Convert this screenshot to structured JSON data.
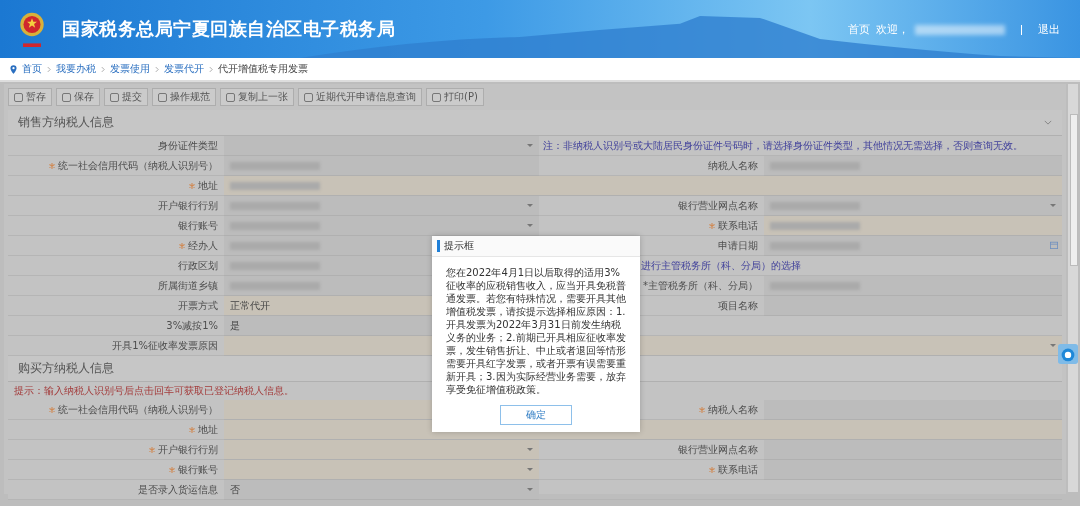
{
  "header": {
    "title": "国家税务总局宁夏回族自治区电子税务局",
    "home_link": "首页",
    "welcome": "欢迎，",
    "logout": "退出"
  },
  "breadcrumb": [
    {
      "label": "首页",
      "current": false
    },
    {
      "label": "我要办税",
      "current": false
    },
    {
      "label": "发票使用",
      "current": false
    },
    {
      "label": "发票代开",
      "current": false
    },
    {
      "label": "代开增值税专用发票",
      "current": true
    }
  ],
  "toolbar": [
    {
      "label": "暂存"
    },
    {
      "label": "保存"
    },
    {
      "label": "提交"
    },
    {
      "label": "操作规范"
    },
    {
      "label": "复制上一张"
    },
    {
      "label": "近期代开申请信息查询"
    },
    {
      "label": "打印(P)"
    }
  ],
  "sections": [
    {
      "title": "销售方纳税人信息",
      "collapsible": true,
      "rows": [
        [
          {
            "kind": "select",
            "label": "身份证件类型",
            "required": false,
            "editable": false,
            "blurred": false
          },
          {
            "kind": "note",
            "text": "注：非纳税人识别号或大陆居民身份证件号码时，请选择身份证件类型，其他情况无需选择，否则查询无效。"
          }
        ],
        [
          {
            "kind": "input",
            "label": "统一社会信用代码（纳税人识别号）",
            "required": true,
            "editable": false,
            "blurred": true
          },
          {
            "kind": "input",
            "label": "纳税人名称",
            "required": false,
            "editable": false,
            "blurred": true
          }
        ],
        [
          {
            "kind": "wide",
            "label": "地址",
            "required": true,
            "editable": true,
            "blurred": true
          }
        ],
        [
          {
            "kind": "select",
            "label": "开户银行行别",
            "required": false,
            "editable": false,
            "blurred": true
          },
          {
            "kind": "select",
            "label": "银行营业网点名称",
            "required": false,
            "editable": false,
            "blurred": true
          }
        ],
        [
          {
            "kind": "select",
            "label": "银行账号",
            "required": false,
            "editable": false,
            "blurred": true
          },
          {
            "kind": "input",
            "label": "联系电话",
            "required": true,
            "editable": true,
            "blurred": true
          }
        ],
        [
          {
            "kind": "input",
            "label": "经办人",
            "required": true,
            "editable": false,
            "blurred": true
          },
          {
            "kind": "date",
            "label": "申请日期",
            "required": false,
            "editable": false,
            "blurred": true
          }
        ],
        [
          {
            "kind": "input",
            "label": "行政区划",
            "required": false,
            "editable": false,
            "blurred": true
          },
          {
            "kind": "trailing_note",
            "text": "进行主管税务所（科、分局）的选择"
          }
        ],
        [
          {
            "kind": "input",
            "label": "所属街道乡镇",
            "required": false,
            "editable": false,
            "blurred": true
          },
          {
            "kind": "input",
            "label": "*主管税务所（科、分局）",
            "required": false,
            "editable": false,
            "blurred": true
          }
        ],
        [
          {
            "kind": "input",
            "label": "开票方式",
            "required": false,
            "editable": true,
            "blurred": false,
            "value": "正常代开"
          },
          {
            "kind": "input",
            "label": "项目名称",
            "required": false,
            "editable": false,
            "blurred": false
          }
        ],
        [
          {
            "kind": "input",
            "label": "3%减按1%",
            "required": false,
            "editable": false,
            "blurred": false,
            "value": "是"
          }
        ],
        [
          {
            "kind": "wideselect",
            "label": "开具1%征收率发票原因",
            "required": false,
            "editable": true,
            "blurred": false
          }
        ]
      ]
    },
    {
      "title": "购买方纳税人信息",
      "collapsible": false,
      "hint": "提示：输入纳税人识别号后点击回车可获取已登记纳税人信息。",
      "rows": [
        [
          {
            "kind": "input",
            "label": "统一社会信用代码（纳税人识别号）",
            "required": true,
            "editable": true,
            "blurred": false
          },
          {
            "kind": "input",
            "label": "纳税人名称",
            "required": true,
            "editable": false,
            "blurred": false
          }
        ],
        [
          {
            "kind": "wide",
            "label": "地址",
            "required": true,
            "editable": true,
            "blurred": false
          }
        ],
        [
          {
            "kind": "select",
            "label": "开户银行行别",
            "required": true,
            "editable": true,
            "blurred": false
          },
          {
            "kind": "input",
            "label": "银行营业网点名称",
            "required": false,
            "editable": false,
            "blurred": false
          }
        ],
        [
          {
            "kind": "select",
            "label": "银行账号",
            "required": true,
            "editable": true,
            "blurred": false
          },
          {
            "kind": "input",
            "label": "联系电话",
            "required": true,
            "editable": false,
            "blurred": false
          }
        ],
        [
          {
            "kind": "select",
            "label": "是否录入货运信息",
            "required": false,
            "editable": false,
            "blurred": false,
            "value": "否"
          }
        ]
      ]
    }
  ],
  "dialog": {
    "title": "提示框",
    "message": "您在2022年4月1日以后取得的适用3%征收率的应税销售收入，应当开具免税普通发票。若您有特殊情况，需要开具其他增值税发票，请按提示选择相应原因：1.开具发票为2022年3月31日前发生纳税义务的业务；2.前期已开具相应征收率发票，发生销售折让、中止或者退回等情形需要开具红字发票，或者开票有误需要重新开具；3.因为实际经营业务需要，放弃享受免征增值税政策。",
    "button": "确定"
  }
}
